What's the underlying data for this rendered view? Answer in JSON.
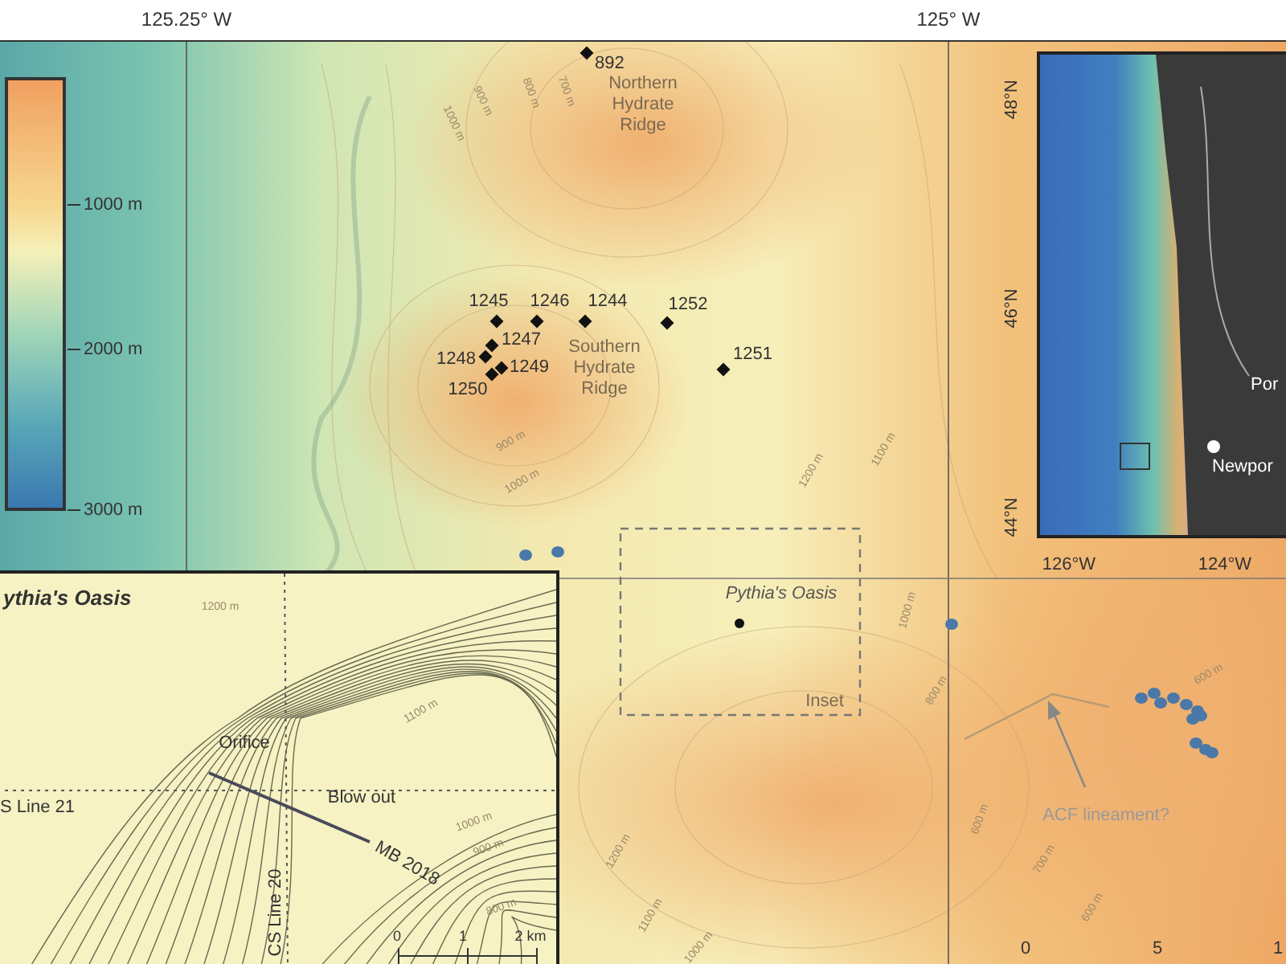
{
  "longitude_labels": [
    "125.25° W",
    "125° W"
  ],
  "depth_legend": {
    "ticks": [
      "1000 m",
      "2000 m",
      "3000 m"
    ]
  },
  "sites": [
    {
      "label": "892"
    },
    {
      "label": "1245"
    },
    {
      "label": "1246"
    },
    {
      "label": "1244"
    },
    {
      "label": "1252"
    },
    {
      "label": "1251"
    },
    {
      "label": "1247"
    },
    {
      "label": "1248"
    },
    {
      "label": "1249"
    },
    {
      "label": "1250"
    }
  ],
  "region_labels": [
    "Northern Hydrate Ridge",
    "Southern Hydrate Ridge"
  ],
  "contour_labels": [
    "1000 m",
    "900 m",
    "800 m",
    "700 m",
    "900 m",
    "1000 m",
    "1200 m",
    "1100 m",
    "1000 m",
    "800 m",
    "600 m",
    "700 m",
    "600 m",
    "600 m",
    "1200 m",
    "1100 m",
    "1000 m"
  ],
  "seep_sites": [
    "Pythia's Oasis"
  ],
  "inset_box_label": "Inset",
  "annotation": "ACF lineament?",
  "scale_labels": [
    "0",
    "5",
    "1"
  ],
  "locator_map": {
    "latitude_labels": [
      "48°N",
      "46°N",
      "44°N"
    ],
    "longitude_labels": [
      "126°W",
      "124°W"
    ],
    "places": [
      "Por",
      "Newpor"
    ]
  },
  "detail_map": {
    "title": "ythia's Oasis",
    "features": [
      "Orifice",
      "Blow out",
      "MB 2018"
    ],
    "survey_lines": [
      "S Line 21",
      "CS Line 20"
    ],
    "contour_labels": [
      "1200 m",
      "1100 m",
      "1000 m",
      "900 m",
      "800 m"
    ],
    "scale_labels": [
      "0",
      "1",
      "2 km"
    ]
  }
}
